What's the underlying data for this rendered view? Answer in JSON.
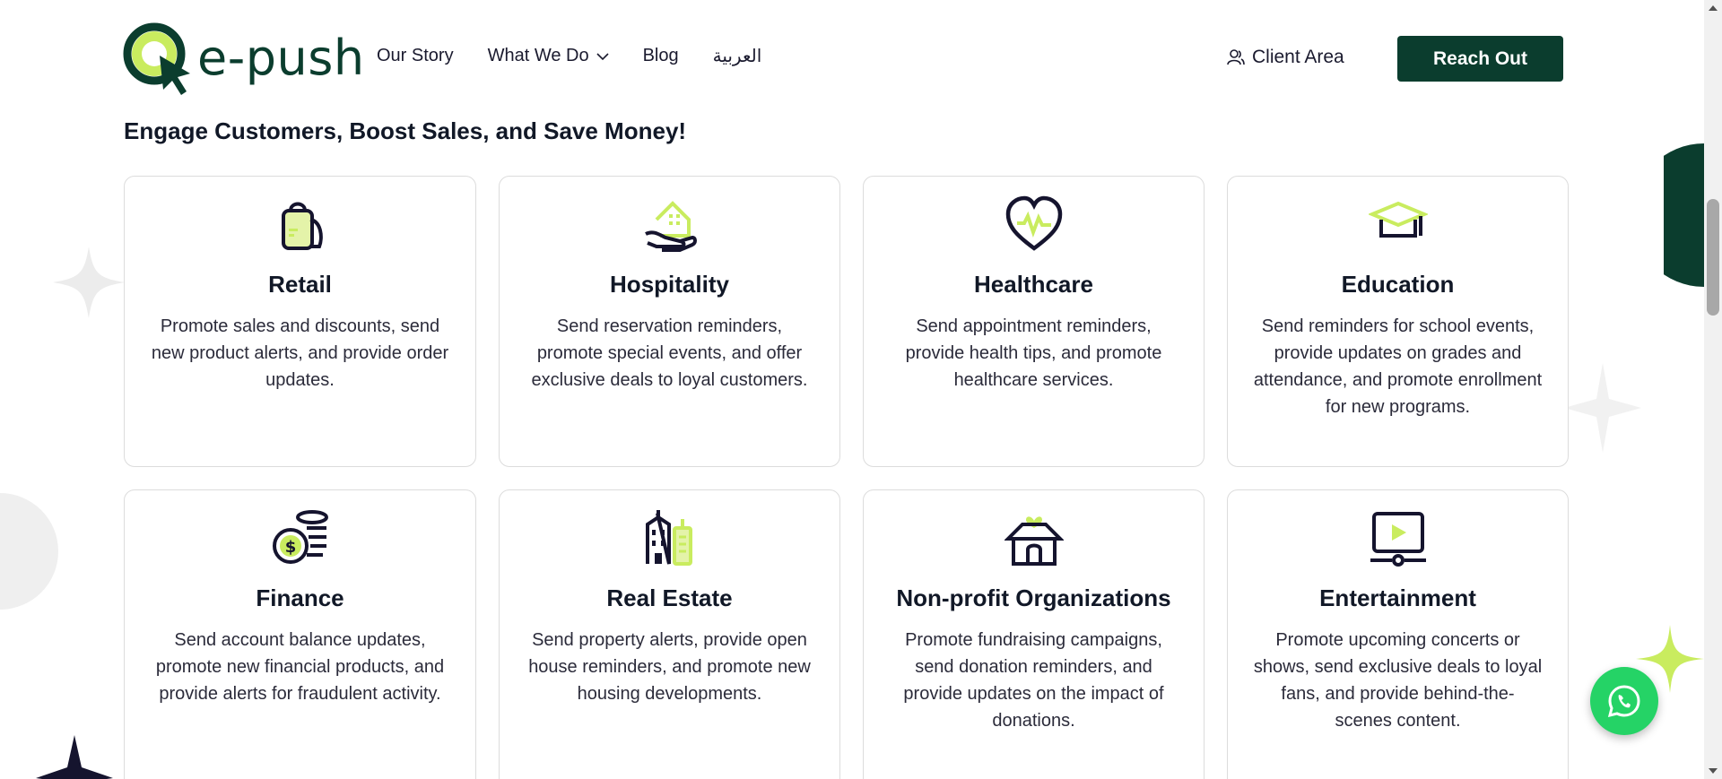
{
  "brand": {
    "name": "e-push",
    "primary_color": "#0b3d2e",
    "accent_color": "#b9e35c"
  },
  "nav": [
    {
      "label": "Our Story"
    },
    {
      "label": "What We Do"
    },
    {
      "label": "Blog"
    },
    {
      "label": "العربية"
    }
  ],
  "header": {
    "client_area": "Client Area",
    "cta": "Reach Out"
  },
  "section": {
    "title": "Engage Customers, Boost Sales, and Save Money!"
  },
  "cards": [
    {
      "icon": "shopping-bag-icon",
      "title": "Retail",
      "desc": "Promote sales and discounts, send new product alerts, and provide order updates."
    },
    {
      "icon": "hand-house-icon",
      "title": "Hospitality",
      "desc": "Send reservation reminders, promote special events, and offer exclusive deals to loyal customers."
    },
    {
      "icon": "heartbeat-icon",
      "title": "Healthcare",
      "desc": "Send appointment reminders, provide health tips, and promote healthcare services."
    },
    {
      "icon": "graduation-cap-icon",
      "title": "Education",
      "desc": "Send reminders for school events, provide updates on grades and attendance, and promote enrollment for new programs."
    },
    {
      "icon": "coins-icon",
      "title": "Finance",
      "desc": "Send account balance updates, promote new financial products, and provide alerts for fraudulent activity."
    },
    {
      "icon": "buildings-icon",
      "title": "Real Estate",
      "desc": "Send property alerts, provide open house reminders, and promote new housing developments."
    },
    {
      "icon": "charity-house-icon",
      "title": "Non-profit Organizations",
      "desc": "Promote fundraising campaigns, send donation reminders, and provide updates on the impact of donations."
    },
    {
      "icon": "video-screen-icon",
      "title": "Entertainment",
      "desc": "Promote upcoming concerts or shows, send exclusive deals to loyal fans, and provide behind-the-scenes content."
    }
  ]
}
